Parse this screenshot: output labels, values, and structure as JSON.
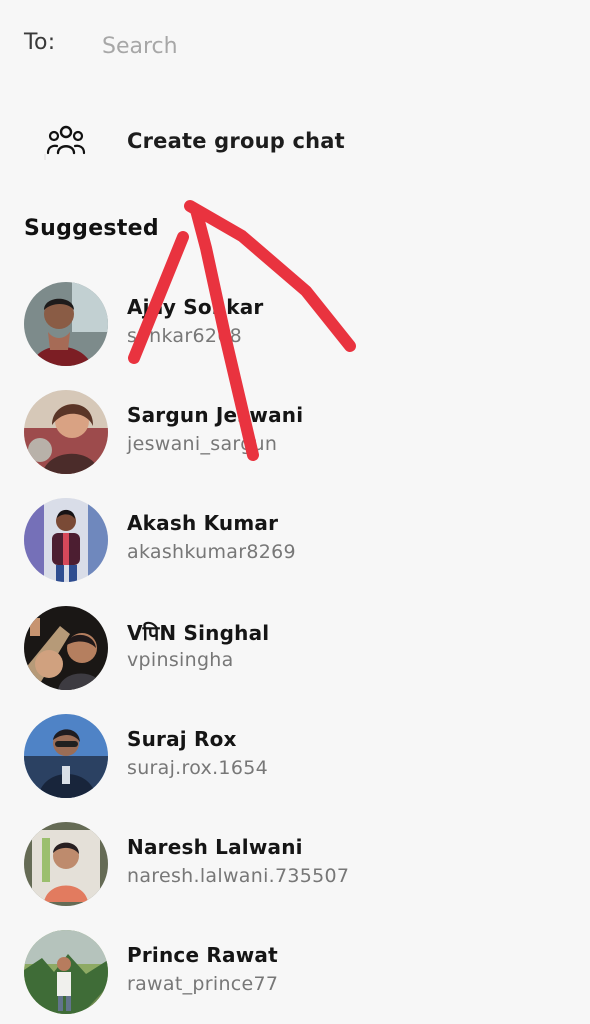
{
  "compose": {
    "to_label": "To:",
    "search_placeholder": "Search"
  },
  "group_chat": {
    "label": "Create group chat",
    "icon": "group-icon"
  },
  "suggested": {
    "title": "Suggested",
    "people": [
      {
        "name": "Ajay Sonkar",
        "username": "sonkar6268"
      },
      {
        "name": "Sargun Jeswani",
        "username": "jeswani_sargun"
      },
      {
        "name": "Akash Kumar",
        "username": "akashkumar8269"
      },
      {
        "name": "VपिN Singhal",
        "username": "vpinsingha"
      },
      {
        "name": "Suraj Rox",
        "username": "suraj.rox.1654"
      },
      {
        "name": "Naresh Lalwani",
        "username": "naresh.lalwani.735507"
      },
      {
        "name": "Prince Rawat",
        "username": "rawat_prince77"
      }
    ]
  },
  "colors": {
    "background": "#f7f7f7",
    "annotation_red": "#e9333f"
  }
}
